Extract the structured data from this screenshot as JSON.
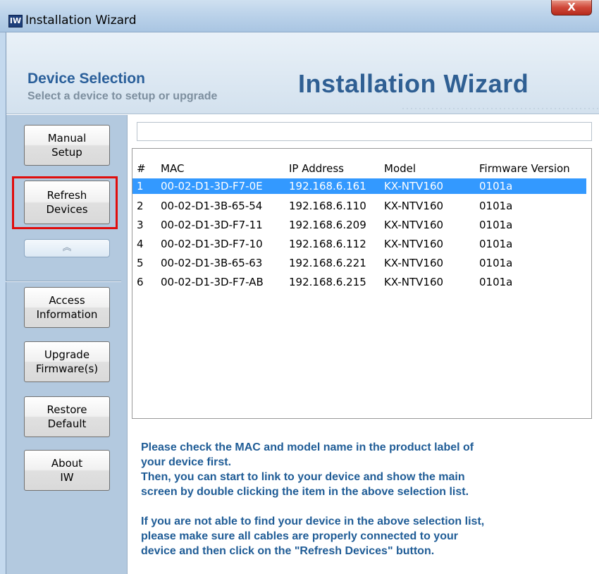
{
  "window": {
    "title": "Installation Wizard",
    "close_label": "X",
    "icon_glyph": "IW"
  },
  "header": {
    "section_title": "Device Selection",
    "section_subtitle": "Select a device to setup or upgrade",
    "brand": "Installation Wizard"
  },
  "sidebar": {
    "manual": [
      "Manual",
      "Setup"
    ],
    "refresh": [
      "Refresh",
      "Devices"
    ],
    "collapse_glyph": "︽",
    "access": [
      "Access",
      "Information"
    ],
    "upgrade": [
      "Upgrade",
      "Firmware(s)"
    ],
    "restore": [
      "Restore",
      "Default"
    ],
    "about": [
      "About",
      "IW"
    ]
  },
  "list": {
    "columns": [
      "#",
      "MAC",
      "IP Address",
      "Model",
      "Firmware Version"
    ],
    "rows": [
      [
        "1",
        "00-02-D1-3D-F7-0E",
        "192.168.6.161",
        "KX-NTV160",
        "0101a"
      ],
      [
        "2",
        "00-02-D1-3B-65-54",
        "192.168.6.110",
        "KX-NTV160",
        "0101a"
      ],
      [
        "3",
        "00-02-D1-3D-F7-11",
        "192.168.6.209",
        "KX-NTV160",
        "0101a"
      ],
      [
        "4",
        "00-02-D1-3D-F7-10",
        "192.168.6.112",
        "KX-NTV160",
        "0101a"
      ],
      [
        "5",
        "00-02-D1-3B-65-63",
        "192.168.6.221",
        "KX-NTV160",
        "0101a"
      ],
      [
        "6",
        "00-02-D1-3D-F7-AB",
        "192.168.6.215",
        "KX-NTV160",
        "0101a"
      ]
    ],
    "selected_row": "1"
  },
  "info": {
    "line1": "Please check the MAC and model name in the product label of",
    "line2": "your device first.",
    "line3": "Then, you can start to link to your device and show the main",
    "line4": "screen by double clicking the item in the above selection list.",
    "line5": "If you are not able to find your device in the above selection list,",
    "line6": "please make sure all cables are properly connected to your",
    "line7": "device and then click on the \"Refresh Devices\" button."
  }
}
